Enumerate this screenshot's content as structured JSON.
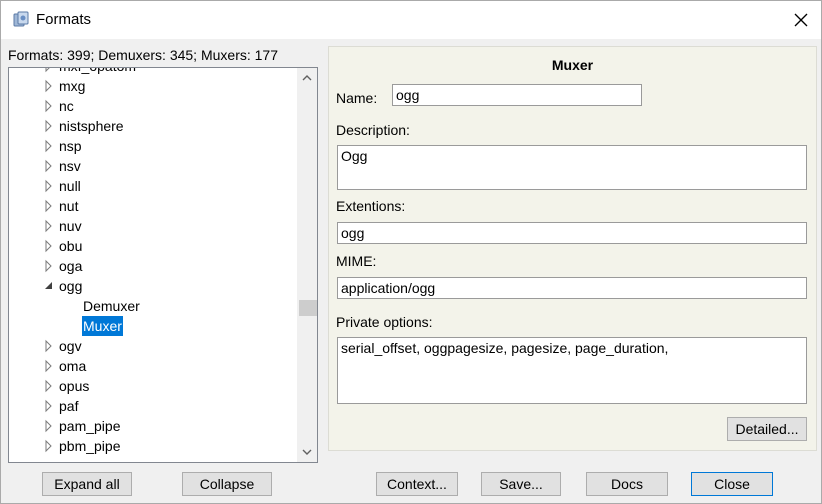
{
  "window": {
    "title": "Formats"
  },
  "summary": "Formats: 399; Demuxers: 345; Muxers: 177",
  "tree": {
    "partial_top_label": "mxf_opatom",
    "items": [
      {
        "label": "mxg",
        "expanded": false
      },
      {
        "label": "nc",
        "expanded": false
      },
      {
        "label": "nistsphere",
        "expanded": false
      },
      {
        "label": "nsp",
        "expanded": false
      },
      {
        "label": "nsv",
        "expanded": false
      },
      {
        "label": "null",
        "expanded": false
      },
      {
        "label": "nut",
        "expanded": false
      },
      {
        "label": "nuv",
        "expanded": false
      },
      {
        "label": "obu",
        "expanded": false
      },
      {
        "label": "oga",
        "expanded": false
      },
      {
        "label": "ogg",
        "expanded": true
      },
      {
        "label": "Demuxer",
        "child": true
      },
      {
        "label": "Muxer",
        "child": true,
        "selected": true
      },
      {
        "label": "ogv",
        "expanded": false
      },
      {
        "label": "oma",
        "expanded": false
      },
      {
        "label": "opus",
        "expanded": false
      },
      {
        "label": "paf",
        "expanded": false
      },
      {
        "label": "pam_pipe",
        "expanded": false
      },
      {
        "label": "pbm_pipe",
        "expanded": false
      }
    ]
  },
  "detail": {
    "heading": "Muxer",
    "name_label": "Name:",
    "name_value": "ogg",
    "description_label": "Description:",
    "description_value": "Ogg",
    "extensions_label": "Extentions:",
    "extensions_value": "ogg",
    "mime_label": "MIME:",
    "mime_value": "application/ogg",
    "private_label": "Private options:",
    "private_value": "serial_offset, oggpagesize, pagesize, page_duration,",
    "detailed_button": "Detailed..."
  },
  "buttons": {
    "expand_all": "Expand all",
    "collapse": "Collapse",
    "context": "Context...",
    "save": "Save...",
    "docs": "Docs",
    "close": "Close"
  },
  "colors": {
    "selection": "#0078d7",
    "panel_bg": "#f3f3ea",
    "window_bg": "#f0f0f0"
  }
}
